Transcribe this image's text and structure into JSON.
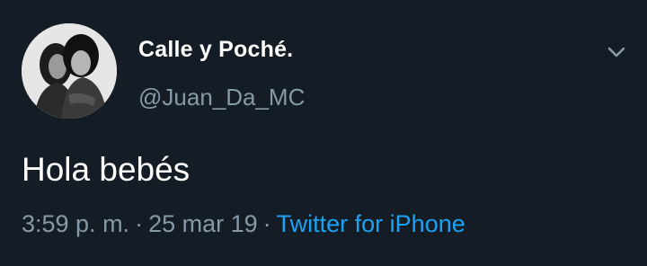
{
  "tweet": {
    "author": {
      "display_name": "Calle y Poché.",
      "handle": "@Juan_Da_MC",
      "avatar_icon": "profile-photo"
    },
    "text": "Hola bebés",
    "meta": {
      "time": "3:59 p. m.",
      "separator": "·",
      "date": "25 mar 19",
      "source": "Twitter for iPhone"
    },
    "menu_icon": "chevron-down-icon"
  },
  "colors": {
    "background": "#141d26",
    "primary_text": "#ffffff",
    "secondary_text": "#8899a6",
    "link": "#1da1f2"
  }
}
